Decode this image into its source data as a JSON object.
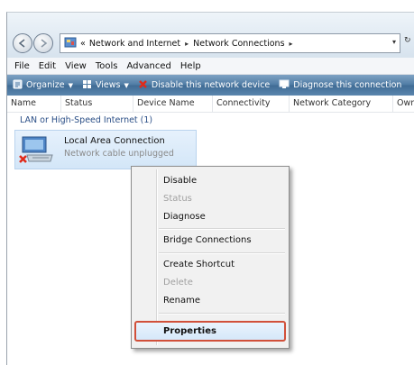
{
  "address": {
    "prefix": "«",
    "crumbs": [
      "Network and Internet",
      "Network Connections"
    ],
    "separator": "▸",
    "dropdown": "▾",
    "refresh": "↻"
  },
  "menubar": [
    "File",
    "Edit",
    "View",
    "Tools",
    "Advanced",
    "Help"
  ],
  "toolbar": {
    "organize": "Organize",
    "views": "Views",
    "disable": "Disable this network device",
    "diagnose": "Diagnose this connection"
  },
  "columns": [
    "Name",
    "Status",
    "Device Name",
    "Connectivity",
    "Network Category",
    "Owner"
  ],
  "group": {
    "header": "LAN or High-Speed Internet (1)"
  },
  "connection": {
    "name": "Local Area Connection",
    "status": "Network cable unplugged"
  },
  "context_menu": {
    "disable": "Disable",
    "status": "Status",
    "diagnose": "Diagnose",
    "bridge": "Bridge Connections",
    "shortcut": "Create Shortcut",
    "delete": "Delete",
    "rename": "Rename",
    "properties": "Properties"
  },
  "colors": {
    "toolbar": "#4e7aa3",
    "highlight_border": "#d1503a",
    "disabled_text": "#a0a0a0",
    "link_blue": "#2b4f87"
  }
}
